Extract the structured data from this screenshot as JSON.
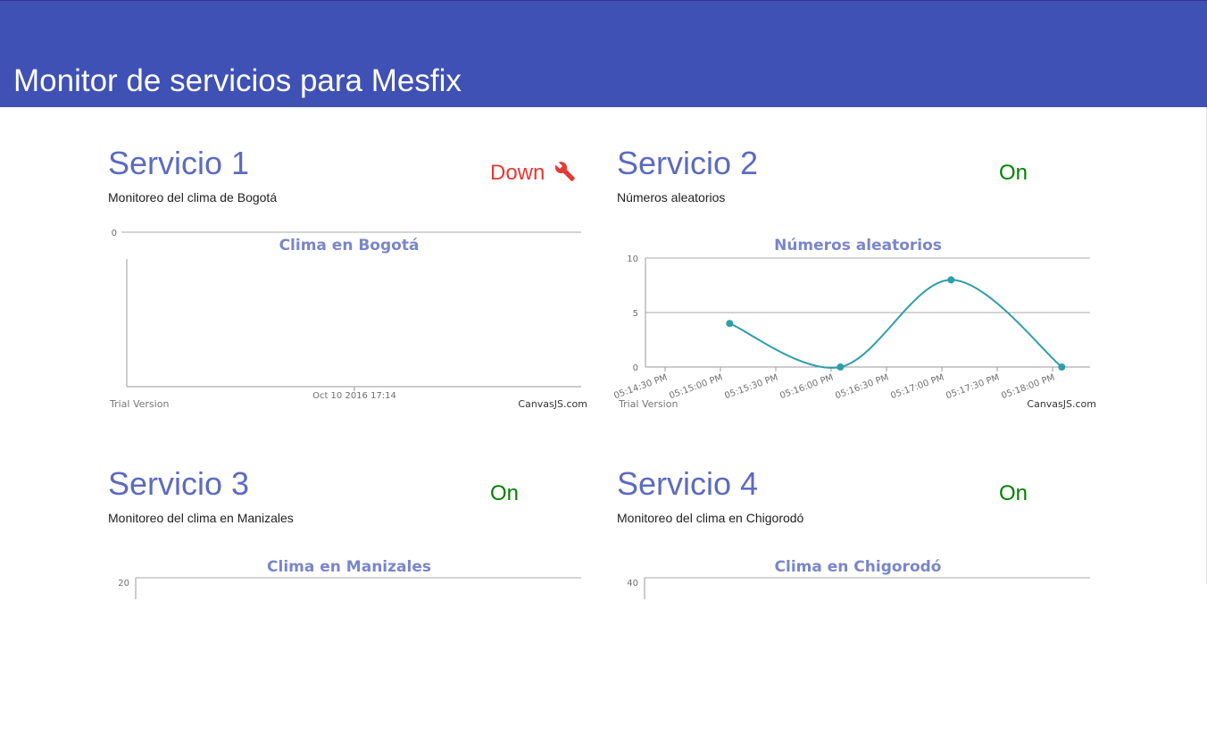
{
  "header": {
    "title": "Monitor de servicios para Mesfix",
    "color": "#3f51b5"
  },
  "icons": {
    "down_status_icon": "wrench-icon"
  },
  "colors": {
    "status_on": "#008000",
    "status_down": "#e53935",
    "service_title": "#5c6bc0",
    "chart_line": "#2e9ea8"
  },
  "services": [
    {
      "title": "Servicio 1",
      "status": "Down",
      "description": "Monitoreo del clima de Bogotá",
      "chart": {
        "title": "Clima en Bogotá",
        "y_tick": "0",
        "x_tick": "Oct 10 2016 17:14",
        "trial": "Trial Version",
        "brand": "CanvasJS.com"
      }
    },
    {
      "title": "Servicio 2",
      "status": "On",
      "description": "Números aleatorios",
      "chart": {
        "title": "Números aleatorios",
        "trial": "Trial Version",
        "brand": "CanvasJS.com"
      }
    },
    {
      "title": "Servicio 3",
      "status": "On",
      "description": "Monitoreo del clima en Manizales",
      "chart": {
        "title": "Clima en Manizales",
        "y_tick": "20"
      }
    },
    {
      "title": "Servicio 4",
      "status": "On",
      "description": "Monitoreo del clima en Chigorodó",
      "chart": {
        "title": "Clima en Chigorodó",
        "y_tick": "40"
      }
    }
  ],
  "chart_data": [
    {
      "type": "line",
      "title": "Clima en Bogotá",
      "x": [
        "Oct 10 2016 17:14"
      ],
      "series": [
        {
          "values": []
        }
      ],
      "y_ticks": [
        0
      ],
      "grid": true
    },
    {
      "type": "line",
      "title": "Números aleatorios",
      "x_ticks": [
        "05:14:30 PM",
        "05:15:00 PM",
        "05:15:30 PM",
        "05:16:00 PM",
        "05:16:30 PM",
        "05:17:00 PM",
        "05:17:30 PM",
        "05:18:00 PM"
      ],
      "x": [
        "05:15:05 PM",
        "05:16:05 PM",
        "05:17:05 PM",
        "05:18:05 PM"
      ],
      "series": [
        {
          "values": [
            4,
            0,
            8,
            0
          ]
        }
      ],
      "y_ticks": [
        0,
        5,
        10
      ],
      "ylim": [
        0,
        10
      ],
      "grid": true
    },
    {
      "type": "line",
      "title": "Clima en Manizales",
      "y_ticks": [
        20
      ],
      "series": [
        {
          "values": []
        }
      ]
    },
    {
      "type": "line",
      "title": "Clima en Chigorodó",
      "y_ticks": [
        40
      ],
      "series": [
        {
          "values": []
        }
      ]
    }
  ]
}
